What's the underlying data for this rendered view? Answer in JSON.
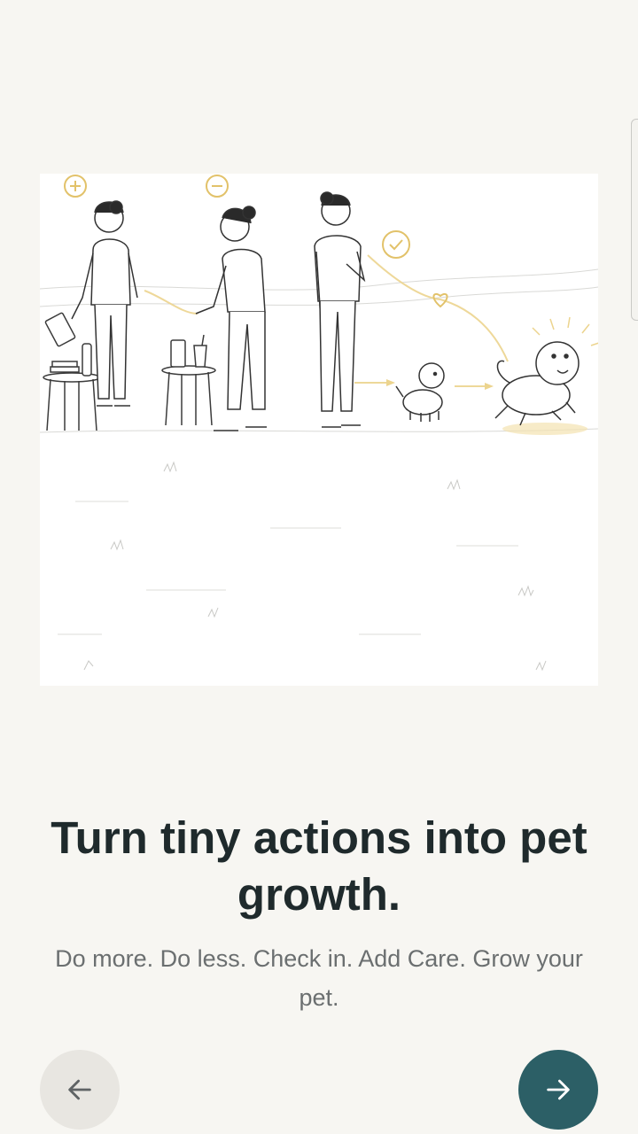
{
  "onboarding": {
    "headline": "Turn tiny actions into pet growth.",
    "subtitle": "Do more. Do less. Check in. Add Care. Grow your pet.",
    "illustration": {
      "icons": [
        "plus-icon",
        "minus-icon",
        "check-icon",
        "heart-icon"
      ],
      "accent_color": "#e8c872"
    }
  },
  "navigation": {
    "back_icon": "arrow-left-icon",
    "next_icon": "arrow-right-icon"
  },
  "colors": {
    "background": "#f7f6f2",
    "primary": "#2c5f66",
    "secondary_button": "#e8e6e1",
    "headline": "#1f2a2c",
    "subtitle": "#6b6f70"
  }
}
